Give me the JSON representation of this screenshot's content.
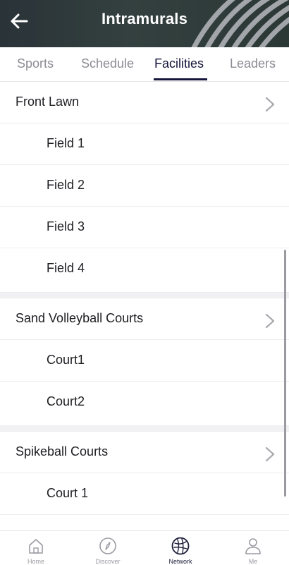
{
  "header": {
    "title": "Intramurals",
    "back_icon": "arrow-left-icon"
  },
  "tabs": [
    {
      "label": "Sports"
    },
    {
      "label": "Schedule"
    },
    {
      "label": "Facilities",
      "active": true
    },
    {
      "label": "Leaders"
    }
  ],
  "facilities": [
    {
      "name": "Front Lawn",
      "items": [
        "Field 1",
        "Field 2",
        "Field 3",
        "Field 4"
      ]
    },
    {
      "name": "Sand Volleyball Courts",
      "items": [
        "Court1",
        "Court2"
      ]
    },
    {
      "name": "Spikeball Courts",
      "items": [
        "Court 1"
      ]
    }
  ],
  "bottom_nav": [
    {
      "label": "Home",
      "icon": "home-icon"
    },
    {
      "label": "Discover",
      "icon": "compass-icon"
    },
    {
      "label": "Network",
      "icon": "network-icon",
      "active": true
    },
    {
      "label": "Me",
      "icon": "person-icon"
    }
  ],
  "colors": {
    "accent": "#16163c",
    "header_bg": "#2f3a3a",
    "muted": "#8c8c94"
  }
}
